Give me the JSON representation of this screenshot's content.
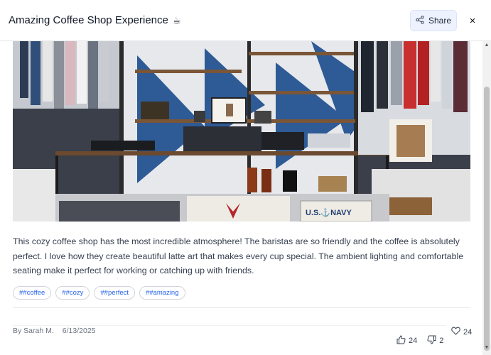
{
  "header": {
    "title": "Amazing Coffee Shop Experience",
    "title_emoji": "☕",
    "share_label": "Share",
    "close_glyph": "×"
  },
  "post": {
    "image_alt": "Clothing boutique interior with shelves, hanging garments and a U.S. NAVY sign",
    "image_sign_text": "U.S.⚓NAVY",
    "description": "This cozy coffee shop has the most incredible atmosphere! The baristas are so friendly and the coffee is absolutely perfect. I love how they create beautiful latte art that makes every cup special. The ambient lighting and comfortable seating make it perfect for working or catching up with friends.",
    "tags": [
      "##coffee",
      "##cozy",
      "##perfect",
      "##amazing"
    ],
    "author": "By Sarah M.",
    "date": "6/13/2025",
    "likes": "24",
    "upvotes": "24",
    "downvotes": "2"
  },
  "colors": {
    "accent": "#2563eb",
    "share_bg": "#eef2ff",
    "divider": "#e5e7eb"
  },
  "icons": [
    "share-icon",
    "close-icon",
    "heart-icon",
    "thumbs-up-icon",
    "thumbs-down-icon",
    "scroll-up-icon",
    "scroll-down-icon"
  ]
}
